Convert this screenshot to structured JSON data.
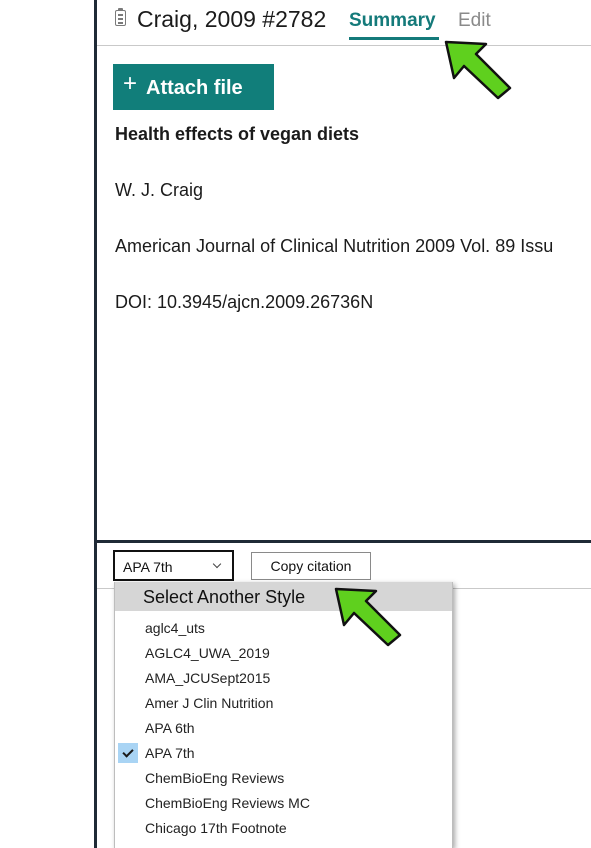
{
  "reference": {
    "title": "Craig, 2009 #2782",
    "icon": "document-clipboard-icon",
    "tabs": [
      {
        "label": "Summary",
        "active": true
      },
      {
        "label": "Edit",
        "active": false
      }
    ],
    "attach_button": {
      "plus": "+",
      "label": "Attach file"
    },
    "article_title": "Health effects of vegan diets",
    "author": "W. J. Craig",
    "journal": "American Journal of Clinical Nutrition 2009 Vol. 89 Issu",
    "doi": "DOI: 10.3945/ajcn.2009.26736N"
  },
  "citation_bar": {
    "selected_style": "APA 7th",
    "copy_label": "Copy citation"
  },
  "style_dropdown": {
    "header": "Select Another Style",
    "items": [
      {
        "label": "aglc4_uts",
        "checked": false
      },
      {
        "label": "AGLC4_UWA_2019",
        "checked": false
      },
      {
        "label": "AMA_JCUSept2015",
        "checked": false
      },
      {
        "label": "Amer J Clin Nutrition",
        "checked": false
      },
      {
        "label": "APA 6th",
        "checked": false
      },
      {
        "label": "APA 7th",
        "checked": true
      },
      {
        "label": "ChemBioEng Reviews",
        "checked": false
      },
      {
        "label": "ChemBioEng Reviews MC",
        "checked": false
      },
      {
        "label": "Chicago 17th Footnote",
        "checked": false
      }
    ]
  },
  "colors": {
    "accent": "#147a7a",
    "attach_button_bg": "#117e7a",
    "annotation_arrow": "#5fd01e",
    "check_highlight": "#a9d4f4"
  }
}
